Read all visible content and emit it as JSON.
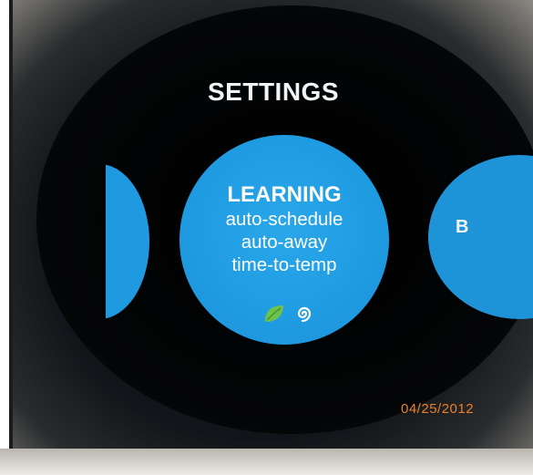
{
  "screen": {
    "title": "SETTINGS",
    "accent_color": "#1f9be2",
    "date_stamp_color": "#e8802a"
  },
  "menu": {
    "selected": {
      "heading": "LEARNING",
      "lines": [
        "auto-schedule",
        "auto-away",
        "time-to-temp"
      ],
      "icons": [
        "leaf-icon",
        "spiral-icon"
      ]
    },
    "next_item_partial_label": "Bl"
  },
  "photo": {
    "date_stamp": "04/25/2012"
  }
}
